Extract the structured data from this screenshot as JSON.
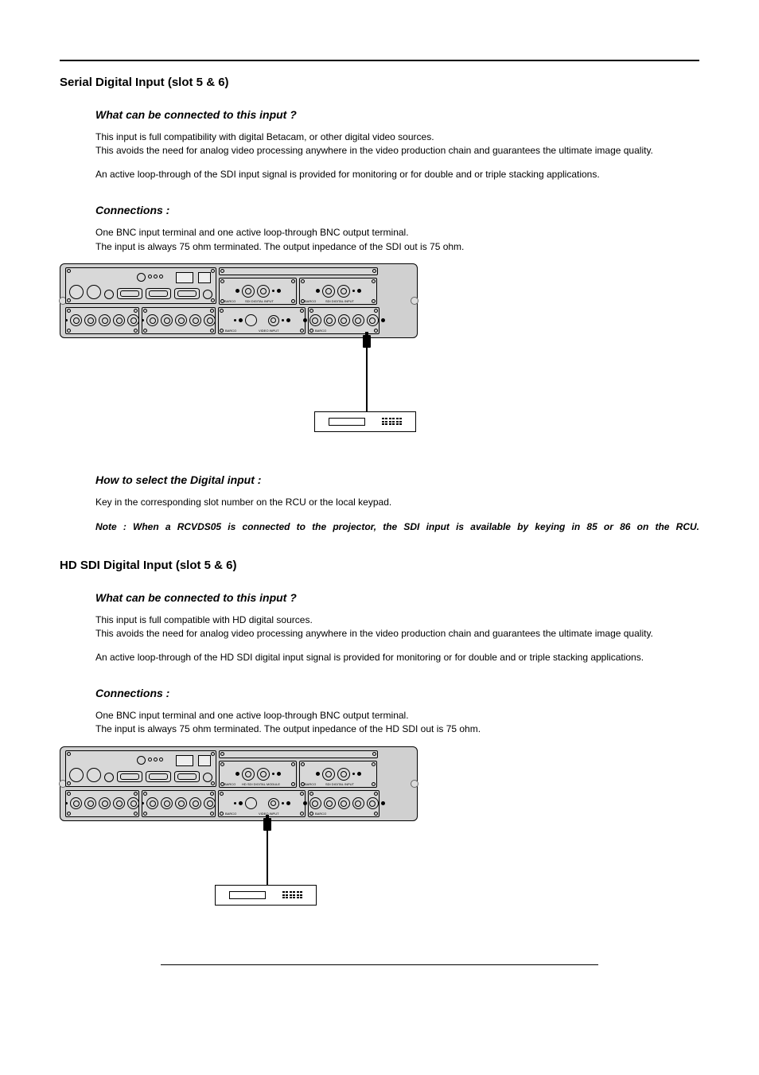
{
  "section1": {
    "title": "Serial Digital Input (slot 5 & 6)",
    "sub1": "What can be connected to this input ?",
    "p1": "This input is full compatibility with digital Betacam, or other digital video sources.",
    "p2": "This avoids the need for analog video processing anywhere in the video production chain and guarantees the ultimate image quality.",
    "p3": "An active loop-through of the SDI input signal is provided for monitoring or for double and or triple stacking applications.",
    "sub2": "Connections :",
    "p4": "One BNC input terminal and one active loop-through BNC output terminal.",
    "p5": "The input is always 75 ohm terminated.  The output inpedance of the SDI out is 75 ohm.",
    "sub3": "How to select the Digital input :",
    "p6": "Key in the corresponding slot number on the RCU or the local keypad.",
    "note": "Note : When a RCVDS05 is connected to the projector, the SDI input is available by keying in 85 or 86 on the RCU.",
    "fig": {
      "sdi_label_a": "SDI DIGITAL INPUT",
      "sdi_label_b": "SDI DIGITAL INPUT",
      "barco": "BARCO",
      "video_input": "VIDEO INPUT"
    }
  },
  "section2": {
    "title": "HD SDI Digital Input (slot 5 & 6)",
    "sub1": "What can be connected to this input ?",
    "p1": "This input is full compatible with HD digital sources.",
    "p2": "This avoids the need for analog video processing anywhere in the video production chain and guarantees the ultimate image quality.",
    "p3": "An active loop-through of the HD SDI digital input signal is provided for monitoring or for double and or triple stacking applications.",
    "sub2": "Connections :",
    "p4": "One BNC input terminal and one active loop-through BNC output terminal.",
    "p5": "The input is always 75 ohm terminated.  The output inpedance of the HD SDI out is 75 ohm.",
    "fig": {
      "sdi_label_a": "HD SDI DIGITAL MODULE",
      "sdi_label_b": "SDI DIGITAL INPUT",
      "barco": "BARCO",
      "video_input": "VIDEO INPUT"
    }
  }
}
